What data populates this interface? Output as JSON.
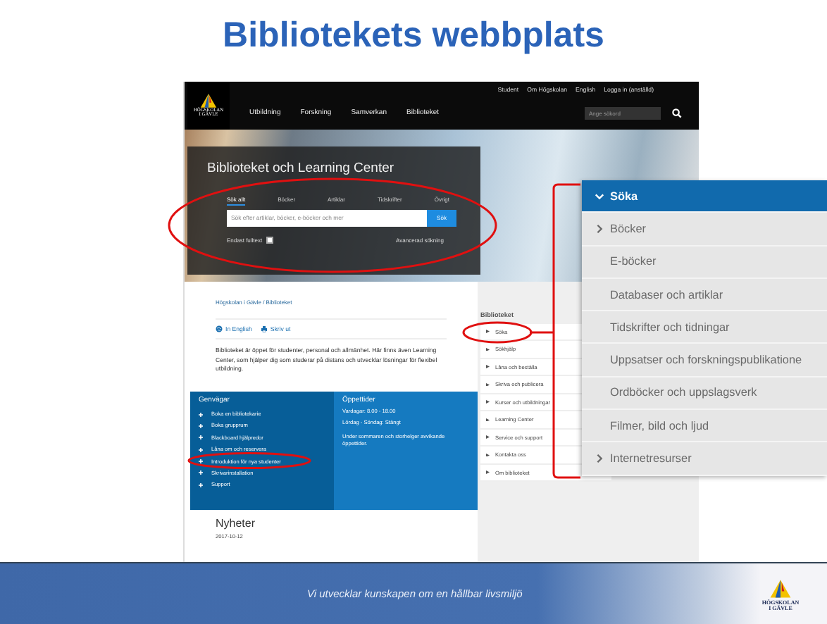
{
  "slide": {
    "title": "Bibliotekets webbplats"
  },
  "site": {
    "utility_links": [
      "Student",
      "Om Högskolan",
      "English",
      "Logga in (anställd)"
    ],
    "logo": [
      "HÖGSKOLAN",
      "I GÄVLE"
    ],
    "nav": [
      "Utbildning",
      "Forskning",
      "Samverkan",
      "Biblioteket"
    ],
    "search": {
      "placeholder": "Ange sökord"
    },
    "hero": {
      "title": "Biblioteket och Learning Center",
      "tabs": [
        {
          "label": "Sök allt",
          "selected": true
        },
        {
          "label": "Böcker",
          "selected": false
        },
        {
          "label": "Artiklar",
          "selected": false
        },
        {
          "label": "Tidskrifter",
          "selected": false
        },
        {
          "label": "Övrigt",
          "selected": false
        }
      ],
      "search": {
        "placeholder": "Sök efter artiklar, böcker, e-böcker och mer",
        "button": "Sök"
      },
      "fulltext": {
        "label": "Endast fulltext",
        "checked": false
      },
      "advanced": "Avancerad sökning"
    },
    "breadcrumb": "Högskolan i Gävle / Biblioteket",
    "actions": [
      {
        "kind": "globe",
        "label": "In English"
      },
      {
        "kind": "print",
        "label": "Skriv ut"
      }
    ],
    "intro": "Biblioteket är öppet för studenter, personal och allmänhet. Här finns även Learning Center, som hjälper dig som studerar på distans och utvecklar lösningar för flexibel utbildning.",
    "shortcuts": {
      "title": "Genvägar",
      "items": [
        "Boka en bibliotekarie",
        "Boka grupprum",
        "Blackboard hjälpredor",
        "Låna om och reservera",
        "Introduktion för nya studenter",
        "Skrivarinstallation",
        "Support"
      ]
    },
    "hours": {
      "title": "Öppettider",
      "lines": [
        "Vardagar: 8.00 - 18.00",
        "Lördag - Söndag: Stängt"
      ],
      "note": "Under sommaren och storhelger avvikande öppettider."
    },
    "news": {
      "title": "Nyheter",
      "date": "2017-10-12"
    },
    "sidebar": {
      "title": "Biblioteket",
      "items": [
        "Söka",
        "Sökhjälp",
        "Låna och beställa",
        "Skriva och publicera",
        "Kurser och utbildningar",
        "Learning Center",
        "Service och support",
        "Kontakta oss",
        "Om biblioteket"
      ]
    }
  },
  "zoom_menu": [
    {
      "label": "Söka",
      "kind": "expanded",
      "selected": true
    },
    {
      "label": "Böcker",
      "kind": "collapsed",
      "selected": false
    },
    {
      "label": "E-böcker",
      "kind": "leaf",
      "selected": false
    },
    {
      "label": "Databaser och artiklar",
      "kind": "leaf",
      "selected": false
    },
    {
      "label": "Tidskrifter och tidningar",
      "kind": "leaf",
      "selected": false
    },
    {
      "label": "Uppsatser och forskningspublikatione",
      "kind": "leaf",
      "selected": false
    },
    {
      "label": "Ordböcker och uppslagsverk",
      "kind": "leaf",
      "selected": false
    },
    {
      "label": "Filmer, bild och ljud",
      "kind": "leaf",
      "selected": false
    },
    {
      "label": "Internetresurser",
      "kind": "collapsed",
      "selected": false
    }
  ],
  "footer": {
    "slogan": "Vi utvecklar kunskapen om en hållbar livsmiljö",
    "logo": [
      "HÖGSKOLAN",
      "I GÄVLE"
    ]
  }
}
